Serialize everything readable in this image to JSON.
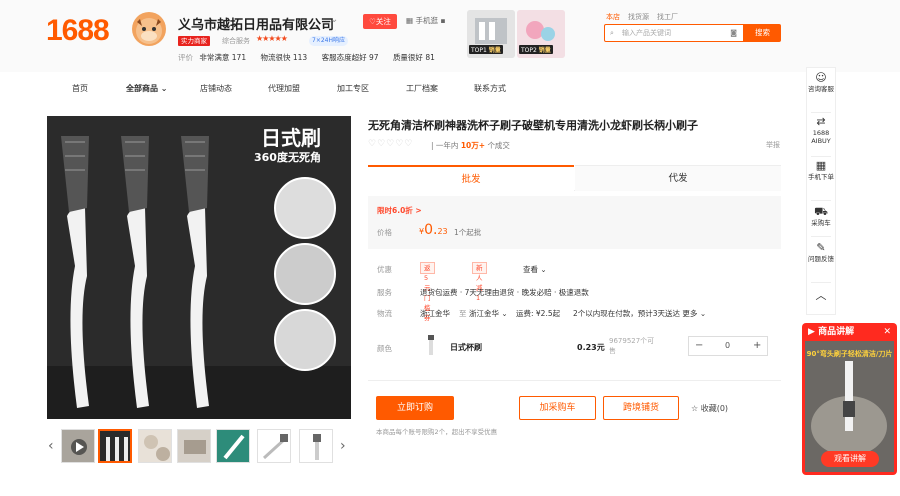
{
  "header": {
    "logo": "1688",
    "shop_name": "义乌市越拓日用品有限公司",
    "follow_label": "♡关注",
    "mobile_label": "手机逛",
    "shop_badge": "实力商家",
    "service_label": "综合服务",
    "stars": "★★★★★",
    "response_badge": "7×24H响应",
    "rating_label": "评价",
    "ratings": [
      {
        "label": "非常满意",
        "value": "171"
      },
      {
        "label": "物流很快",
        "value": "113"
      },
      {
        "label": "客服态度超好",
        "value": "97"
      },
      {
        "label": "质量很好",
        "value": "81"
      }
    ],
    "top_cards": [
      {
        "tag": "TOP1",
        "tag_text": "销量"
      },
      {
        "tag": "TOP2",
        "tag_text": "销量"
      }
    ],
    "search_tabs": [
      "本店",
      "找货源",
      "找工厂"
    ],
    "search_placeholder": "输入产品关键词",
    "search_button": "搜索"
  },
  "nav": {
    "items": [
      "首页",
      "全部商品",
      "店铺动态",
      "代理加盟",
      "加工专区",
      "工厂档案",
      "联系方式"
    ]
  },
  "product": {
    "title": "无死角清洁杯刷神器洗杯子刷子破壁机专用清洗小龙虾刷长柄小刷子",
    "stars": "♡♡♡♡♡",
    "sales_prefix": "一年内",
    "sales_value": "10万+",
    "sales_suffix": "个成交",
    "report": "举报",
    "image_text_main": "日式刷",
    "image_text_sub": "360度无死角",
    "tabs": [
      "批发",
      "代发"
    ],
    "promo": "限时6.0折 >",
    "price_label": "价格",
    "price_symbol": "¥",
    "price_int": "0.",
    "price_dec": "23",
    "moq": "1个起批",
    "discount": {
      "label": "优惠",
      "coupons": [
        "返5元门槛券",
        "新人减1"
      ],
      "more": "查看"
    },
    "service": {
      "label": "服务",
      "text": "退货包运费 · 7天无理由退货 · 晚发必赔 · 极速退款"
    },
    "logistics": {
      "label": "物流",
      "from": "浙江金华",
      "to": "浙江金华",
      "fee": "运费: ¥2.5起",
      "eta": "2个以内现在付款，预计3天送达 更多"
    },
    "color": {
      "label": "颜色",
      "name": "日式杯刷",
      "price": "0.23元",
      "stock": "9679527个可售",
      "qty": "0"
    },
    "buttons": {
      "buy": "立即订购",
      "cart": "加采购车",
      "dropship": "跨境铺货",
      "fav": "收藏(0)"
    },
    "note": "本商品每个账号限购2个，超出不享受优惠"
  },
  "side": {
    "items": [
      "咨询客服",
      "1688 AIBUY",
      "手机下单",
      "采购车",
      "问题反馈"
    ]
  },
  "video": {
    "header": "商品讲解",
    "caption": "90°弯头刷子轻松清洁/刀片",
    "button": "观看讲解"
  },
  "colors": {
    "accent": "#ff5a00",
    "red": "#ff2a1f"
  }
}
